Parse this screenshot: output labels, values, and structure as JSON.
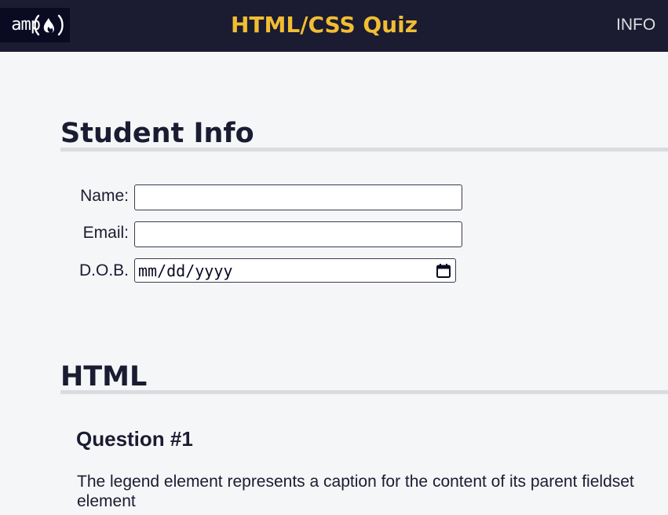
{
  "header": {
    "logo_text": "amp",
    "title": "HTML/CSS Quiz",
    "nav_info": "INFO",
    "title_color": "#f1be32",
    "bar_color": "#1b1b32"
  },
  "student_info": {
    "heading": "Student Info",
    "name_label": "Name:",
    "name_value": "",
    "email_label": "Email:",
    "email_value": "",
    "dob_label": "D.O.B.",
    "dob_placeholder": "mm/dd/yyyy",
    "dob_icon": "calendar-icon"
  },
  "html_section": {
    "heading": "HTML",
    "question_title": "Question #1",
    "question_text": "The legend element represents a caption for the content of its parent fieldset element"
  }
}
